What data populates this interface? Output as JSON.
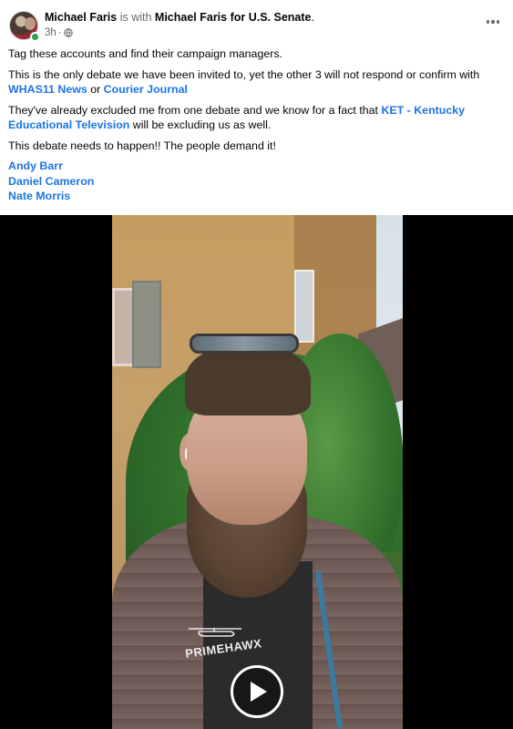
{
  "post": {
    "author": "Michael Faris",
    "with_text": "is with",
    "tagged_page": "Michael Faris for U.S. Senate",
    "period": ".",
    "time": "3h",
    "dot": "·",
    "privacy_icon": "globe-icon",
    "more_icon": "more-options-icon"
  },
  "body": {
    "p1": "Tag these accounts and find their campaign managers.",
    "p2_a": "This is the only debate we have been invited to, yet the other 3 will not respond or confirm with ",
    "p2_link1": "WHAS11 News",
    "p2_b": " or ",
    "p2_link2": "Courier Journal",
    "p3_a": "They've already excluded me from one debate and we know for a fact that ",
    "p3_link": "KET - Kentucky Educational Television",
    "p3_b": " will be excluding us as well.",
    "p4": "This debate needs to happen!! The people demand it!",
    "mentions": [
      "Andy Barr",
      "Daniel Cameron",
      "Nate Morris"
    ]
  },
  "video": {
    "jacket_logo": "PRIMEHAWX",
    "play_icon": "play-icon"
  },
  "colors": {
    "link": "#1b74e4",
    "secondary_text": "#65676b",
    "online": "#31a24c"
  }
}
